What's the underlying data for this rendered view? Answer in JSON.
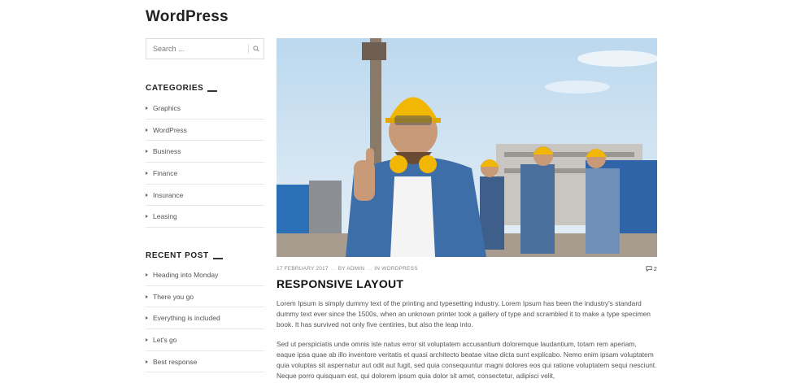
{
  "site": {
    "title": "WordPress"
  },
  "search": {
    "placeholder": "Search ..."
  },
  "sidebar": {
    "categories_title": "CATEGORIES",
    "categories": [
      "Graphics",
      "WordPress",
      "Business",
      "Finance",
      "Insurance",
      "Leasing"
    ],
    "recent_title": "RECENT POST",
    "recent": [
      "Heading into Monday",
      "There you go",
      "Everything is included",
      "Let's go",
      "Best response"
    ]
  },
  "post": {
    "date": "17 FEBRUARY 2017",
    "author": "BY ADMIN",
    "category": "IN WORDPRESS",
    "separator": "...",
    "comments": "2",
    "title": "RESPONSIVE LAYOUT",
    "paragraph1": "Lorem Ipsum is simply dummy text of the printing and typesetting industry. Lorem Ipsum has been the industry's standard dummy text ever since the 1500s, when an unknown printer took a gallery of type and scrambled it to make a type specimen book. It has survived not only five centiries, but also the leap into.",
    "paragraph2": "Sed ut perspiciatis unde omnis iste natus error sit voluptatem accusantium doloremque laudantium, totam rem aperiam, eaque ipsa quae ab illo inventore veritatis et quasi architecto beatae vitae dicta sunt explicabo. Nemo enim ipsam voluptatem quia voluptas sit aspernatur aut odit aut fugit, sed quia consequuntur magni dolores eos qui ratione voluptatem sequi nesciunt. Neque porro quisquam est, qui dolorem ipsum quia dolor sit amet, consectetur, adipisci velit,"
  },
  "colors": {
    "accent": "#222222",
    "helmet": "#f2b705",
    "sky": "#cfe3f3"
  }
}
